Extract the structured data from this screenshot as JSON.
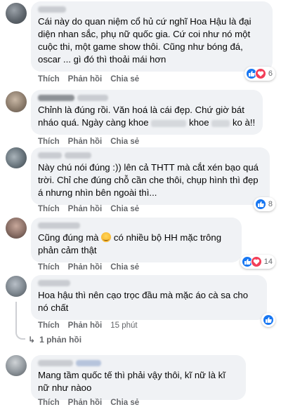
{
  "actions": {
    "like": "Thích",
    "reply": "Phản hồi",
    "share": "Chia sẻ"
  },
  "comments": [
    {
      "text": "Cái này do quan niệm cổ hủ cứ nghĩ Hoa Hậu là đại diện nhan sắc, phụ nữ quốc gia. Cứ coi như nó một cuộc thi, một game show thôi. Cũng như bóng đá, oscar ... gì đó thì thoải mái hơn",
      "reactions": [
        "like",
        "love"
      ],
      "reaction_count": "6"
    },
    {
      "text_before": "Chỉnh là đúng rồi. Văn hoá là cái đẹp. Chứ giờ bát nháo quá. Ngày càng khoe",
      "text_mid": "khoe",
      "text_after": "ko à!!",
      "reactions": [],
      "reaction_count": ""
    },
    {
      "text": "Này chú nói đúng :)) lên cả THTT mà cắt xén bạo quá trời. Chỉ che đúng chỗ cần che thôi, chụp hình thì đẹp á nhưng nhìn bên ngoài thì...",
      "reactions": [
        "like"
      ],
      "reaction_count": "8"
    },
    {
      "text_before": "Cũng đúng mà",
      "text_after": "có nhiều bộ HH mặc trông phản cảm thật",
      "reactions": [
        "like",
        "love"
      ],
      "reaction_count": "14"
    },
    {
      "text": "Hoa hậu thì nên cạo trọc đầu mà mặc áo cà sa cho nó chất",
      "time": "15 phút",
      "reactions": [
        "like"
      ],
      "reaction_count": "",
      "replies_label": "1 phản hồi"
    },
    {
      "text": "Mang tầm quốc tế thì phải vậy thôi, kĩ nữ là kĩ nữ như nàoo",
      "reactions": [],
      "reaction_count": ""
    }
  ],
  "colors": {
    "like": "#1877f2",
    "love": "#f33e58",
    "bubble": "#f0f2f5",
    "meta": "#65676b"
  }
}
